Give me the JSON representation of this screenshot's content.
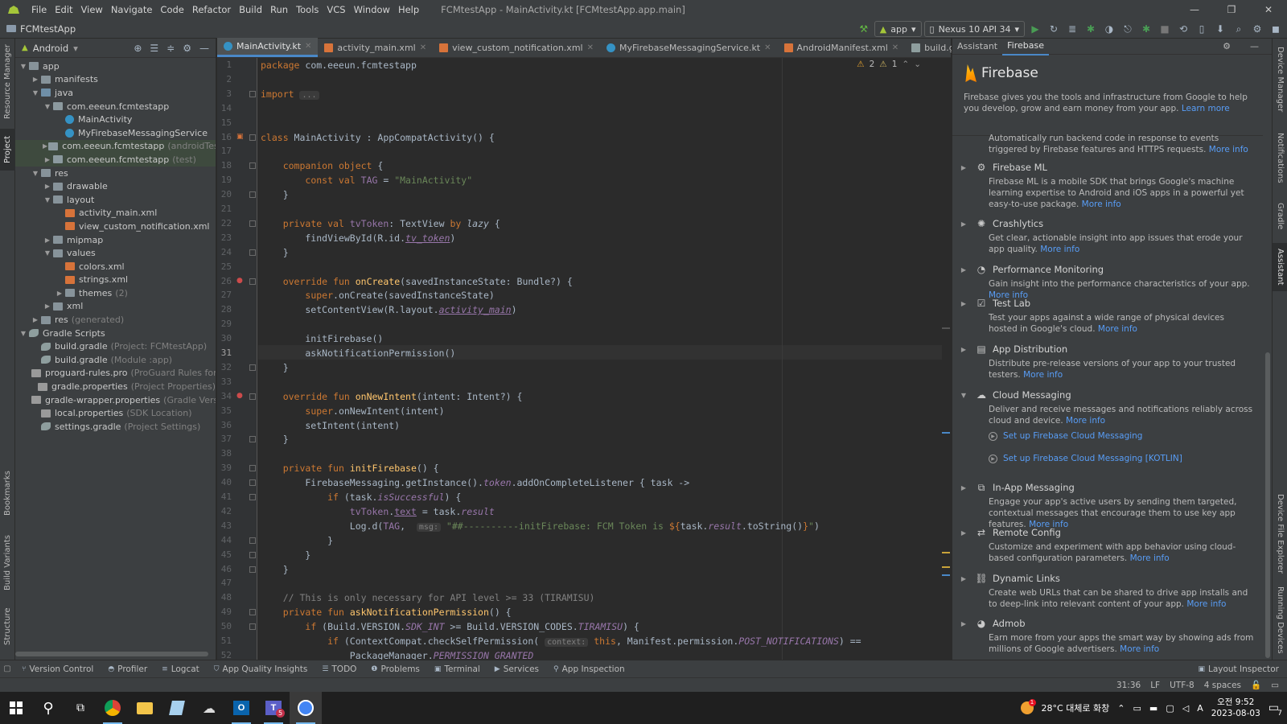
{
  "menu": [
    "File",
    "Edit",
    "View",
    "Navigate",
    "Code",
    "Refactor",
    "Build",
    "Run",
    "Tools",
    "VCS",
    "Window",
    "Help"
  ],
  "window_title": "FCMtestApp - MainActivity.kt [FCMtestApp.app.main]",
  "window_controls": [
    "—",
    "❐",
    "✕"
  ],
  "breadcrumb": "FCMtestApp",
  "run_config": "app",
  "device": "Nexus 10 API 34",
  "project_panel": {
    "view_mode": "Android",
    "tree": [
      {
        "depth": 0,
        "arrow": "▼",
        "icon": "folder",
        "label": "app",
        "dim": ""
      },
      {
        "depth": 1,
        "arrow": "▶",
        "icon": "folder",
        "label": "manifests",
        "dim": ""
      },
      {
        "depth": 1,
        "arrow": "▼",
        "icon": "src",
        "label": "java",
        "dim": ""
      },
      {
        "depth": 2,
        "arrow": "▼",
        "icon": "pkg",
        "label": "com.eeeun.fcmtestapp",
        "dim": ""
      },
      {
        "depth": 3,
        "arrow": "",
        "icon": "kt",
        "label": "MainActivity",
        "dim": ""
      },
      {
        "depth": 3,
        "arrow": "",
        "icon": "kt",
        "label": "MyFirebaseMessagingService",
        "dim": ""
      },
      {
        "depth": 2,
        "arrow": "▶",
        "icon": "pkg",
        "label": "com.eeeun.fcmtestapp",
        "dim": "(androidTest)",
        "sel": true
      },
      {
        "depth": 2,
        "arrow": "▶",
        "icon": "pkg",
        "label": "com.eeeun.fcmtestapp",
        "dim": "(test)",
        "sel": true
      },
      {
        "depth": 1,
        "arrow": "▼",
        "icon": "folder",
        "label": "res",
        "dim": ""
      },
      {
        "depth": 2,
        "arrow": "▶",
        "icon": "folder",
        "label": "drawable",
        "dim": ""
      },
      {
        "depth": 2,
        "arrow": "▼",
        "icon": "folder",
        "label": "layout",
        "dim": ""
      },
      {
        "depth": 3,
        "arrow": "",
        "icon": "xml",
        "label": "activity_main.xml",
        "dim": ""
      },
      {
        "depth": 3,
        "arrow": "",
        "icon": "xml",
        "label": "view_custom_notification.xml",
        "dim": ""
      },
      {
        "depth": 2,
        "arrow": "▶",
        "icon": "folder",
        "label": "mipmap",
        "dim": ""
      },
      {
        "depth": 2,
        "arrow": "▼",
        "icon": "folder",
        "label": "values",
        "dim": ""
      },
      {
        "depth": 3,
        "arrow": "",
        "icon": "xml",
        "label": "colors.xml",
        "dim": ""
      },
      {
        "depth": 3,
        "arrow": "",
        "icon": "xml",
        "label": "strings.xml",
        "dim": ""
      },
      {
        "depth": 3,
        "arrow": "▶",
        "icon": "folder",
        "label": "themes",
        "dim": "(2)"
      },
      {
        "depth": 2,
        "arrow": "▶",
        "icon": "folder",
        "label": "xml",
        "dim": ""
      },
      {
        "depth": 1,
        "arrow": "▶",
        "icon": "folder",
        "label": "res",
        "dim": "(generated)"
      },
      {
        "depth": 0,
        "arrow": "▼",
        "icon": "gradle",
        "label": "Gradle Scripts",
        "dim": ""
      },
      {
        "depth": 1,
        "arrow": "",
        "icon": "gradle",
        "label": "build.gradle",
        "dim": "(Project: FCMtestApp)"
      },
      {
        "depth": 1,
        "arrow": "",
        "icon": "gradle",
        "label": "build.gradle",
        "dim": "(Module :app)"
      },
      {
        "depth": 1,
        "arrow": "",
        "icon": "file",
        "label": "proguard-rules.pro",
        "dim": "(ProGuard Rules for \":app"
      },
      {
        "depth": 1,
        "arrow": "",
        "icon": "file",
        "label": "gradle.properties",
        "dim": "(Project Properties)"
      },
      {
        "depth": 1,
        "arrow": "",
        "icon": "file",
        "label": "gradle-wrapper.properties",
        "dim": "(Gradle Version)"
      },
      {
        "depth": 1,
        "arrow": "",
        "icon": "file",
        "label": "local.properties",
        "dim": "(SDK Location)"
      },
      {
        "depth": 1,
        "arrow": "",
        "icon": "gradle",
        "label": "settings.gradle",
        "dim": "(Project Settings)"
      }
    ]
  },
  "left_tool_tabs": [
    "Resource Manager",
    "Project",
    "Bookmarks",
    "Build Variants",
    "Structure"
  ],
  "right_tool_tabs": [
    "Device Manager",
    "Notifications",
    "Gradle",
    "Assistant",
    "Device File Explorer",
    "Running Devices"
  ],
  "editor_tabs": [
    {
      "label": "MainActivity.kt",
      "type": "kt",
      "active": true
    },
    {
      "label": "activity_main.xml",
      "type": "xml"
    },
    {
      "label": "view_custom_notification.xml",
      "type": "xml"
    },
    {
      "label": "MyFirebaseMessagingService.kt",
      "type": "kt"
    },
    {
      "label": "AndroidManifest.xml",
      "type": "xml"
    },
    {
      "label": "build.gradle (:app)",
      "type": "gradle"
    }
  ],
  "inspections": {
    "warnings": "2",
    "weak_warnings": "1"
  },
  "current_line": "31",
  "code_lines": [
    {
      "n": "1",
      "html": "<span class=\"kw\">package</span> com.eeeun.fcmtestapp"
    },
    {
      "n": "2",
      "html": ""
    },
    {
      "n": "3",
      "html": "<span class=\"kw\">import</span> <span class=\"hint\">...</span>"
    },
    {
      "n": "14",
      "html": ""
    },
    {
      "n": "15",
      "html": ""
    },
    {
      "n": "16",
      "html": "<span class=\"kw\">class</span> MainActivity : AppCompatActivity() {"
    },
    {
      "n": "17",
      "html": ""
    },
    {
      "n": "18",
      "html": "    <span class=\"kw\">companion object</span> {"
    },
    {
      "n": "19",
      "html": "        <span class=\"kw\">const val</span> <span class=\"purp\">TAG</span> = <span class=\"str\">\"MainActivity\"</span>"
    },
    {
      "n": "20",
      "html": "    }"
    },
    {
      "n": "21",
      "html": ""
    },
    {
      "n": "22",
      "html": "    <span class=\"kw\">private val</span> <span class=\"purp\">tvToken</span>: TextView <span class=\"kw\">by</span> <span class=\"ital\">lazy</span> {"
    },
    {
      "n": "23",
      "html": "        findViewById(R.id.<span class=\"prop ul\">tv_token</span>)"
    },
    {
      "n": "24",
      "html": "    }"
    },
    {
      "n": "25",
      "html": ""
    },
    {
      "n": "26",
      "html": "    <span class=\"kw\">override fun</span> <span class=\"fn\">onCreate</span>(savedInstanceState: Bundle?) {"
    },
    {
      "n": "27",
      "html": "        <span class=\"kw\">super</span>.onCreate(savedInstanceState)"
    },
    {
      "n": "28",
      "html": "        setContentView(R.layout.<span class=\"prop ul\">activity_main</span>)"
    },
    {
      "n": "29",
      "html": ""
    },
    {
      "n": "30",
      "html": "        initFirebase()"
    },
    {
      "n": "31",
      "html": "        askNotificationPermission()"
    },
    {
      "n": "32",
      "html": "    }"
    },
    {
      "n": "33",
      "html": ""
    },
    {
      "n": "34",
      "html": "    <span class=\"kw\">override fun</span> <span class=\"fn\">onNewIntent</span>(intent: Intent?) {"
    },
    {
      "n": "35",
      "html": "        <span class=\"kw\">super</span>.onNewIntent(intent)"
    },
    {
      "n": "36",
      "html": "        setIntent(intent)"
    },
    {
      "n": "37",
      "html": "    }"
    },
    {
      "n": "38",
      "html": ""
    },
    {
      "n": "39",
      "html": "    <span class=\"kw\">private fun</span> <span class=\"fn\">initFirebase</span>() {"
    },
    {
      "n": "40",
      "html": "        FirebaseMessaging.getInstance().<span class=\"prop\">token</span>.addOnCompleteListener { task -&gt;"
    },
    {
      "n": "41",
      "html": "            <span class=\"kw\">if</span> (task.<span class=\"prop\">isSuccessful</span>) {"
    },
    {
      "n": "42",
      "html": "                <span class=\"purp\">tvToken</span>.<span class=\"purp ul\">text</span> = task.<span class=\"prop\">result</span>"
    },
    {
      "n": "43",
      "html": "                Log.d(<span class=\"purp\">TAG</span>,  <span class=\"hint\">msg:</span> <span class=\"str\">\"##----------initFirebase: FCM Token is </span><span class=\"kw\">${</span>task.<span class=\"prop\">result</span>.toString()<span class=\"kw\">}</span><span class=\"str\">\"</span>)"
    },
    {
      "n": "44",
      "html": "            }"
    },
    {
      "n": "45",
      "html": "        }"
    },
    {
      "n": "46",
      "html": "    }"
    },
    {
      "n": "47",
      "html": ""
    },
    {
      "n": "48",
      "html": "    <span class=\"cmt\">// This is only necessary for API level &gt;= 33 (TIRAMISU)</span>"
    },
    {
      "n": "49",
      "html": "    <span class=\"kw\">private fun</span> <span class=\"fn\">askNotificationPermission</span>() {"
    },
    {
      "n": "50",
      "html": "        <span class=\"kw\">if</span> (Build.VERSION.<span class=\"prop\">SDK_INT</span> &gt;= Build.VERSION_CODES.<span class=\"prop\">TIRAMISU</span>) {"
    },
    {
      "n": "51",
      "html": "            <span class=\"kw\">if</span> (ContextCompat.checkSelfPermission( <span class=\"hint\">context:</span> <span class=\"kw\">this</span>, Manifest.permission.<span class=\"prop\">POST_NOTIFICATIONS</span>) =="
    },
    {
      "n": "52",
      "html": "                PackageManager.<span class=\"prop\">PERMISSION_GRANTED</span>"
    }
  ],
  "assistant": {
    "tabs": [
      "Assistant",
      "Firebase"
    ],
    "active_tab": "Firebase",
    "brand": "Firebase",
    "intro": "Firebase gives you the tools and infrastructure from Google to help you develop, grow and earn money from your app.",
    "learn_more": "Learn more",
    "truncated_desc": "Automatically run backend code in response to events triggered by Firebase features and HTTPS requests.",
    "more_info": "More info",
    "features": [
      {
        "title": "Firebase ML",
        "icon": "robot-icon",
        "glyph": "⚙",
        "expanded": false,
        "desc": "Firebase ML is a mobile SDK that brings Google's machine learning expertise to Android and iOS apps in a powerful yet easy-to-use package."
      },
      {
        "title": "Crashlytics",
        "icon": "crashlytics-icon",
        "glyph": "✺",
        "expanded": false,
        "desc": "Get clear, actionable insight into app issues that erode your app quality."
      },
      {
        "title": "Performance Monitoring",
        "icon": "gauge-icon",
        "glyph": "◔",
        "expanded": false,
        "desc": "Gain insight into the performance characteristics of your app."
      },
      {
        "title": "Test Lab",
        "icon": "test-lab-icon",
        "glyph": "☑",
        "expanded": false,
        "desc": "Test your apps against a wide range of physical devices hosted in Google's cloud."
      },
      {
        "title": "App Distribution",
        "icon": "app-distribution-icon",
        "glyph": "▤",
        "expanded": false,
        "desc": "Distribute pre-release versions of your app to your trusted testers."
      },
      {
        "title": "Cloud Messaging",
        "icon": "cloud-icon",
        "glyph": "☁",
        "expanded": true,
        "desc": "Deliver and receive messages and notifications reliably across cloud and device."
      },
      {
        "title": "In-App Messaging",
        "icon": "in-app-messaging-icon",
        "glyph": "⧉",
        "expanded": false,
        "desc": "Engage your app's active users by sending them targeted, contextual messages that encourage them to use key app features."
      },
      {
        "title": "Remote Config",
        "icon": "remote-config-icon",
        "glyph": "⇄",
        "expanded": false,
        "desc": "Customize and experiment with app behavior using cloud-based configuration parameters."
      },
      {
        "title": "Dynamic Links",
        "icon": "link-icon",
        "glyph": "⛓",
        "expanded": false,
        "desc": "Create web URLs that can be shared to drive app installs and to deep-link into relevant content of your app."
      },
      {
        "title": "Admob",
        "icon": "admob-icon",
        "glyph": "◕",
        "expanded": false,
        "desc": "Earn more from your apps the smart way by showing ads from millions of Google advertisers."
      }
    ],
    "cloud_messaging_links": [
      "Set up Firebase Cloud Messaging",
      "Set up Firebase Cloud Messaging [KOTLIN]"
    ]
  },
  "bottom_tools": [
    {
      "label": "Version Control",
      "glyph": "⑂"
    },
    {
      "label": "Profiler",
      "glyph": "◓"
    },
    {
      "label": "Logcat",
      "glyph": "≡"
    },
    {
      "label": "App Quality Insights",
      "glyph": "⛉"
    },
    {
      "label": "TODO",
      "glyph": "☰"
    },
    {
      "label": "Problems",
      "glyph": "❶"
    },
    {
      "label": "Terminal",
      "glyph": "▣"
    },
    {
      "label": "Services",
      "glyph": "▶"
    },
    {
      "label": "App Inspection",
      "glyph": "⚲"
    }
  ],
  "layout_inspector": "Layout Inspector",
  "status": {
    "position": "31:36",
    "line_sep": "LF",
    "encoding": "UTF-8",
    "indent": "4 spaces"
  },
  "taskbar": {
    "weather": "28°C 대체로 화창",
    "weather_badge": "1",
    "ime": "A",
    "time": "오전 9:52",
    "date": "2023-08-03",
    "notifications": "7",
    "teams_badge": "5"
  }
}
